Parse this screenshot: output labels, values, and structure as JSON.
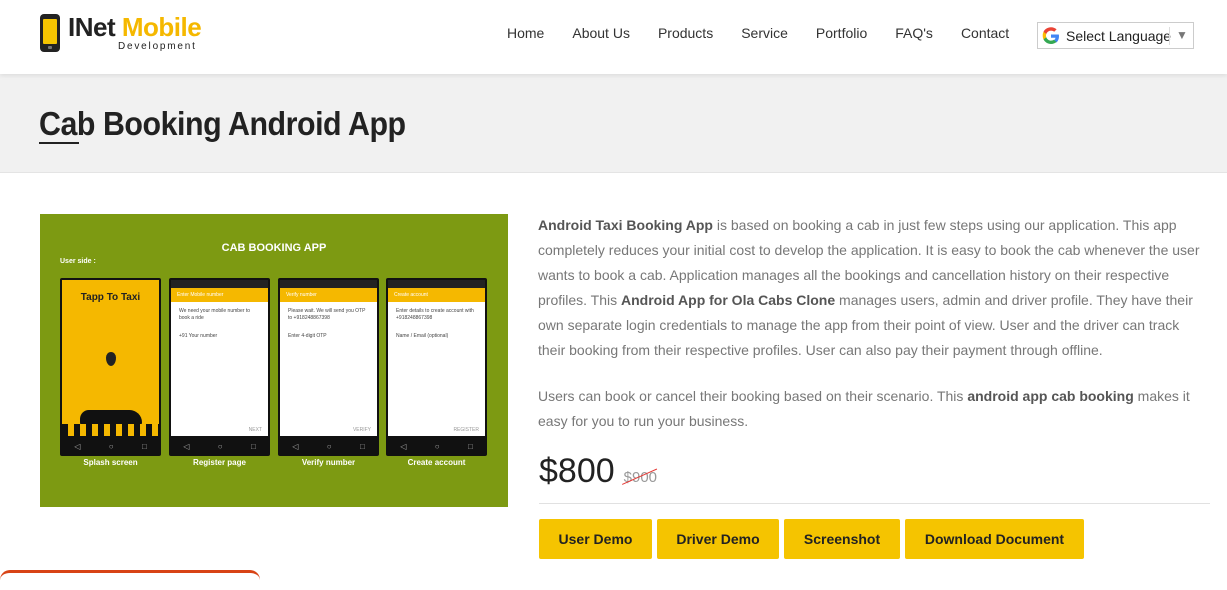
{
  "header": {
    "logo_main_1": "INet ",
    "logo_main_2": "Mobile",
    "logo_sub": "Development",
    "nav": [
      "Home",
      "About Us",
      "Products",
      "Service",
      "Portfolio",
      "FAQ's",
      "Contact"
    ],
    "language_label": "Select Language"
  },
  "page": {
    "title": "Cab Booking Android App"
  },
  "product_image": {
    "title": "CAB BOOKING APP",
    "user_side": "User side :",
    "screens": [
      {
        "label": "Splash screen",
        "app_name": "Tapp To Taxi"
      },
      {
        "label": "Register page",
        "bar": "Enter Mobile number",
        "text": "We need your mobile number to book a ride",
        "field": "+91   Your number",
        "foot": "NEXT"
      },
      {
        "label": "Verify number",
        "bar": "Verify number",
        "text": "Please wait. We will send you OTP to +918248867398",
        "field": "Enter 4-digit OTP",
        "foot": "VERIFY"
      },
      {
        "label": "Create account",
        "bar": "Create account",
        "text": "Enter details to create account with +918248867398",
        "field": "Name / Email (optional)",
        "foot": "REGISTER"
      }
    ]
  },
  "description": {
    "p1_b1": "Android Taxi Booking App",
    "p1_t1": " is based on booking a cab in just few steps using our application. This app completely reduces your initial cost to develop the application. It is easy to book the cab whenever the user wants to book a cab. Application manages all the bookings and cancellation history on their respective profiles. This ",
    "p1_b2": "Android App for Ola Cabs Clone",
    "p1_t2": " manages users, admin and driver profile. They have their own separate login credentials to manage the app from their point of view. User and the driver can track their booking from their respective profiles. User can also pay their payment through offline.",
    "p2_t1": "Users can book or cancel their booking based on their scenario. This ",
    "p2_b1": "android app cab booking",
    "p2_t2": " makes it easy for you to run your business."
  },
  "pricing": {
    "price": "$800",
    "old_price": "$900"
  },
  "buttons": [
    "User Demo",
    "Driver Demo",
    "Screenshot",
    "Download Document"
  ]
}
